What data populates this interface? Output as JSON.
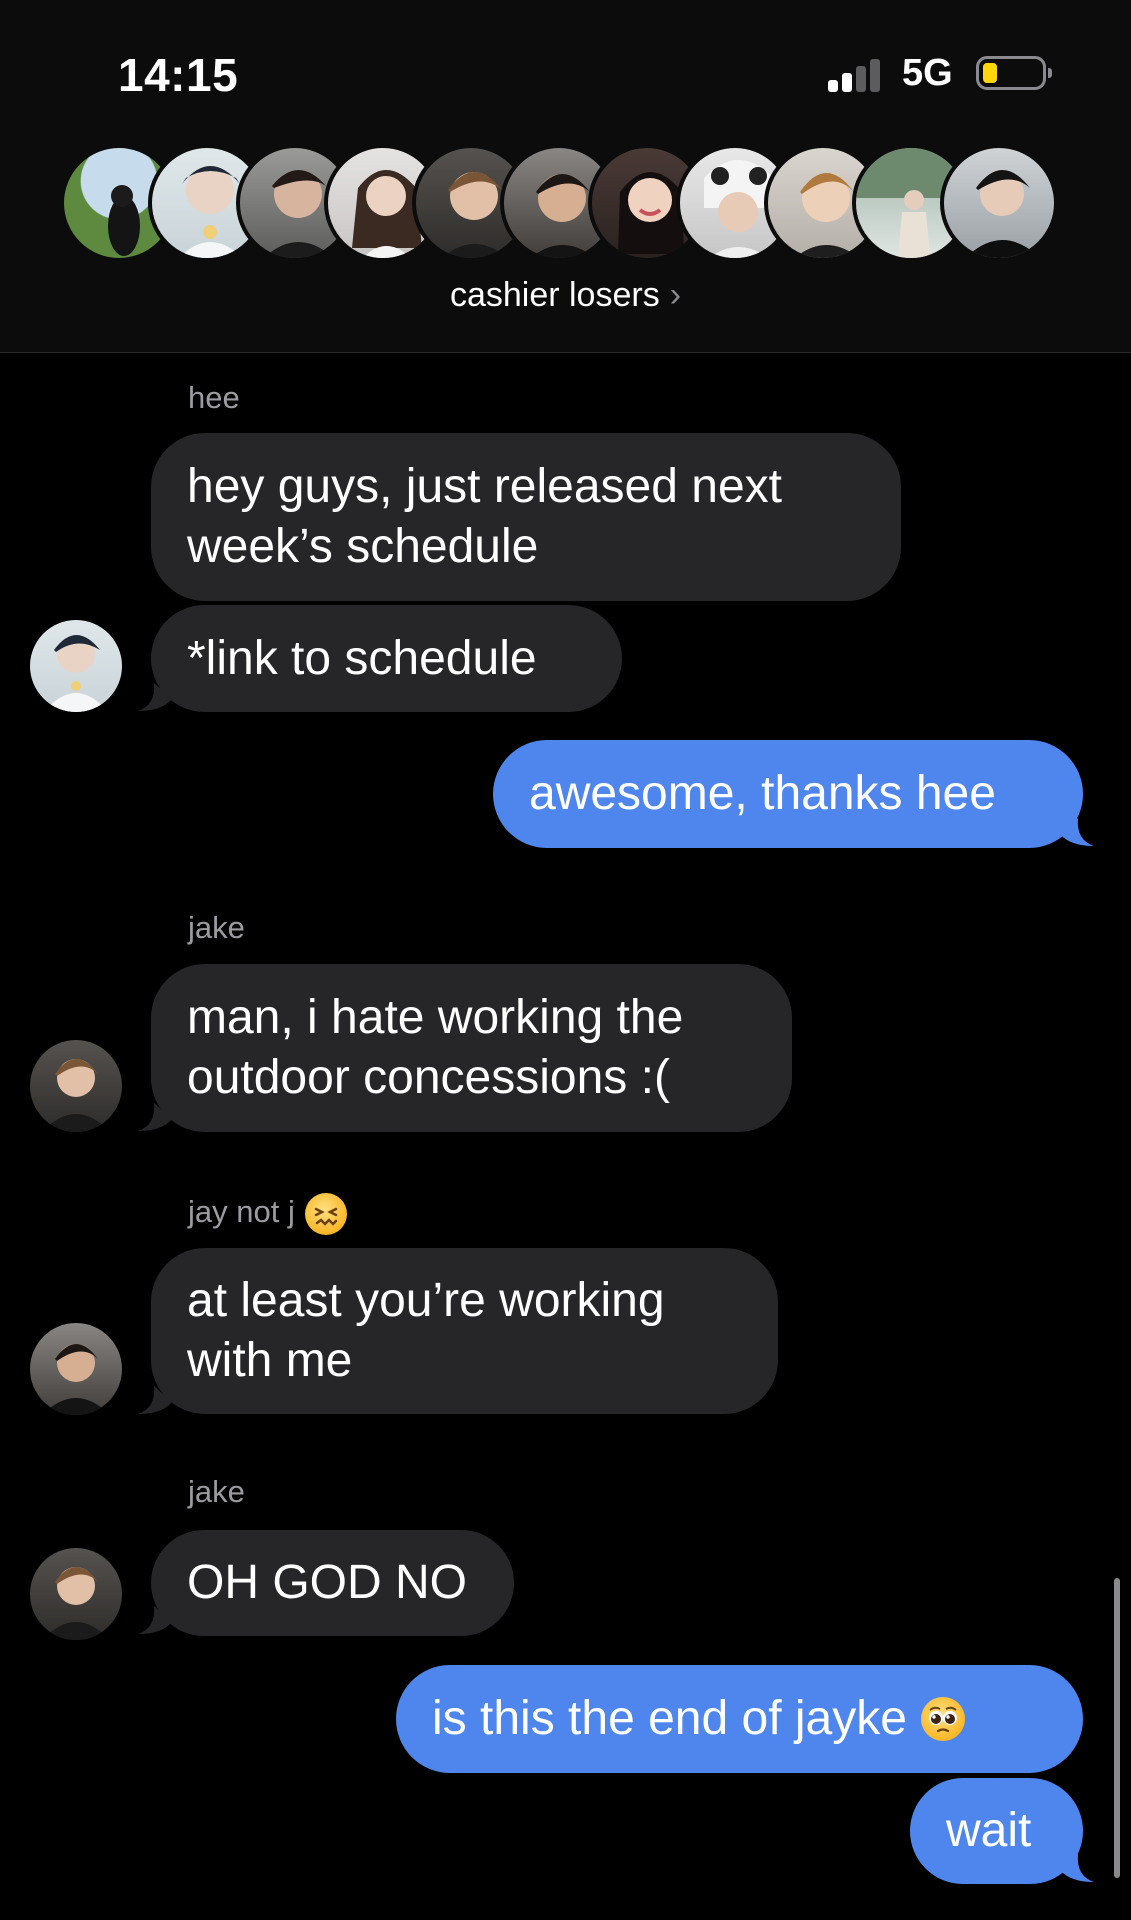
{
  "status_bar": {
    "time": "14:15",
    "network": "5G"
  },
  "group": {
    "name": "cashier losers",
    "avatar_count": 11
  },
  "messages": [
    {
      "sender": "hee",
      "text": "hey guys, just released next week’s schedule",
      "direction": "incoming"
    },
    {
      "text": "*link to schedule",
      "direction": "incoming"
    },
    {
      "text": "awesome, thanks hee",
      "direction": "outgoing"
    },
    {
      "sender": "jake",
      "text": "man, i hate working the outdoor concessions :(",
      "direction": "incoming"
    },
    {
      "sender": "jay not j",
      "text": "at least you’re working with me",
      "direction": "incoming"
    },
    {
      "sender": "jake",
      "text": "OH GOD NO",
      "direction": "incoming"
    },
    {
      "text": "is this the end of jayke",
      "direction": "outgoing"
    },
    {
      "text": "wait",
      "direction": "outgoing"
    }
  ],
  "colors": {
    "incoming_bubble": "#262629",
    "outgoing_bubble": "#4f86ee",
    "background": "#000000",
    "battery": "#ffd60a"
  },
  "icons": {
    "sender_emoji": "confounded-face-icon",
    "message_emoji": "pleading-face-icon",
    "chevron": "chevron-right-icon"
  }
}
